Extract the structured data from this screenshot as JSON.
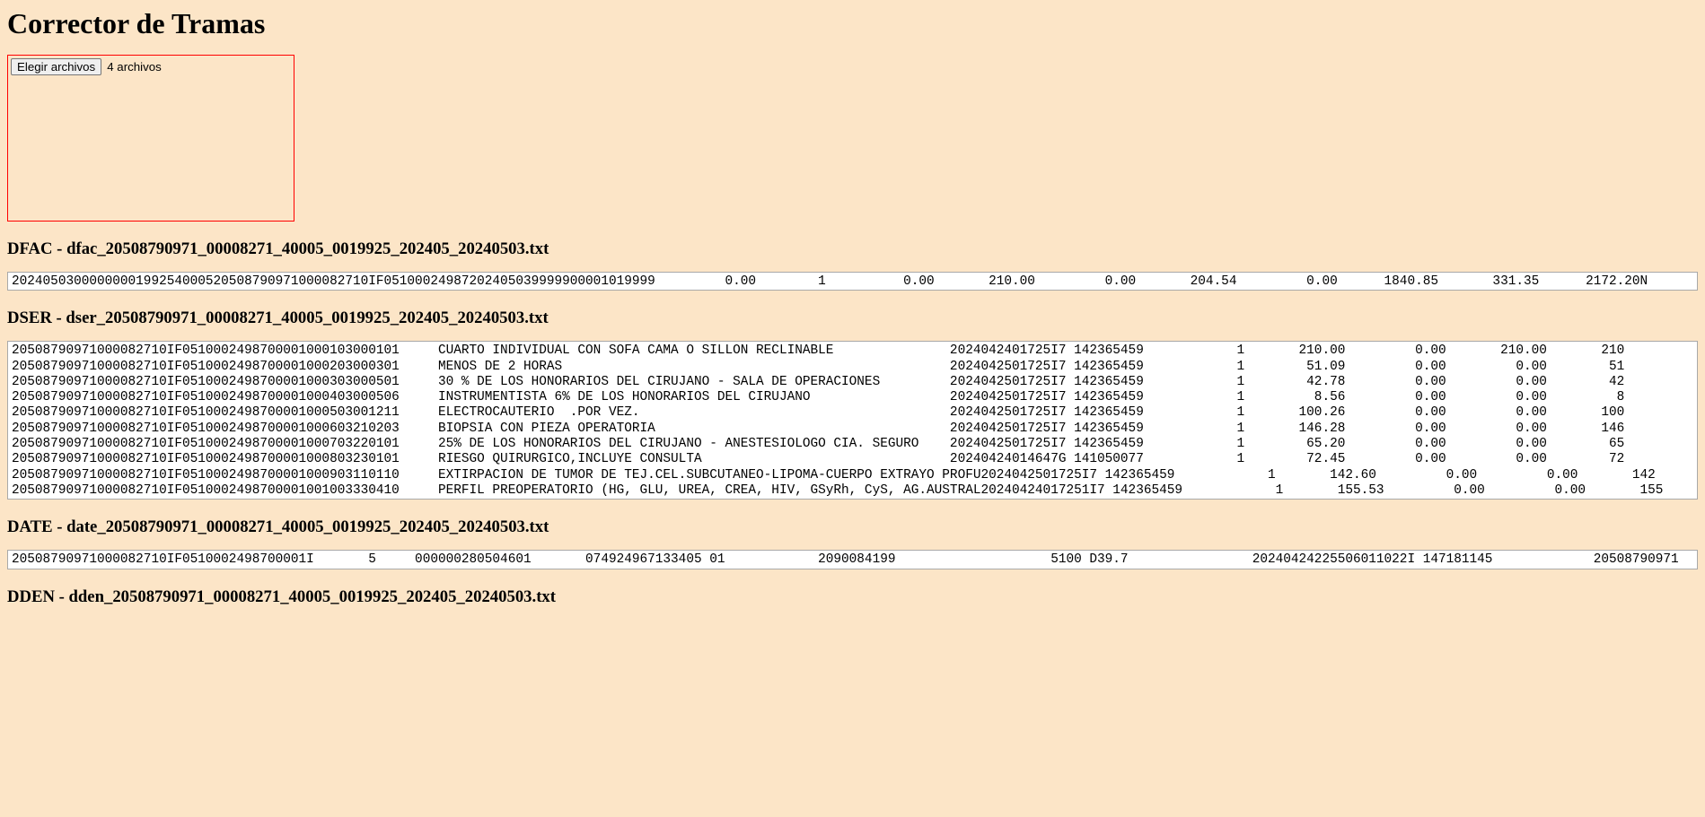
{
  "title": "Corrector de Tramas",
  "filePicker": {
    "buttonLabel": "Elegir archivos",
    "statusLabel": "4 archivos"
  },
  "sections": {
    "dfac": {
      "heading": "DFAC - dfac_20508790971_00008271_40005_0019925_202405_20240503.txt",
      "content": "2024050300000000199254000520508790971000082710IF05100024987202405039999900001019999         0.00        1          0.00       210.00         0.00       204.54         0.00      1840.85       331.35      2172.20N                                                                           "
    },
    "dser": {
      "heading": "DSER - dser_20508790971_00008271_40005_0019925_202405_20240503.txt",
      "content": "20508790971000082710IF0510002498700001000103000101     CUARTO INDIVIDUAL CON SOFA CAMA O SILLON RECLINABLE               2024042401725I7 142365459            1       210.00         0.00       210.00       210\n20508790971000082710IF0510002498700001000203000301     MENOS DE 2 HORAS                                                  2024042501725I7 142365459            1        51.09         0.00         0.00        51\n20508790971000082710IF0510002498700001000303000501     30 % DE LOS HONORARIOS DEL CIRUJANO - SALA DE OPERACIONES         2024042501725I7 142365459            1        42.78         0.00         0.00        42\n20508790971000082710IF0510002498700001000403000506     INSTRUMENTISTA 6% DE LOS HONORARIOS DEL CIRUJANO                  2024042501725I7 142365459            1         8.56         0.00         0.00         8\n20508790971000082710IF0510002498700001000503001211     ELECTROCAUTERIO  .POR VEZ.                                        2024042501725I7 142365459            1       100.26         0.00         0.00       100\n20508790971000082710IF0510002498700001000603210203     BIOPSIA CON PIEZA OPERATORIA                                      2024042501725I7 142365459            1       146.28         0.00         0.00       146\n20508790971000082710IF0510002498700001000703220101     25% DE LOS HONORARIOS DEL CIRUJANO - ANESTESIOLOGO CIA. SEGURO    2024042501725I7 142365459            1        65.20         0.00         0.00        65\n20508790971000082710IF0510002498700001000803230101     RIESGO QUIRURGICO,INCLUYE CONSULTA                                20240424014647G 141050077            1        72.45         0.00         0.00        72\n20508790971000082710IF0510002498700001000903110110     EXTIRPACION DE TUMOR DE TEJ.CEL.SUBCUTANEO-LIPOMA-CUERPO EXTRAYO PROFU2024042501725I7 142365459            1       142.60         0.00         0.00       142\n20508790971000082710IF0510002498700001001003330410     PERFIL PREOPERATORIO (HG, GLU, UREA, CREA, HIV, GSyRh, CyS, AG.AUSTRAL20240424017251I7 142365459            1       155.53         0.00         0.00       155"
    },
    "date": {
      "heading": "DATE - date_20508790971_00008271_40005_0019925_202405_20240503.txt",
      "content": "20508790971000082710IF0510002498700001I       5     000000280504601       074924967133405 01            2090084199                    5100 D39.7                20240424225506011022I 147181145             20508790971                                                                                                                                   "
    },
    "dden": {
      "heading": "DDEN - dden_20508790971_00008271_40005_0019925_202405_20240503.txt"
    }
  }
}
